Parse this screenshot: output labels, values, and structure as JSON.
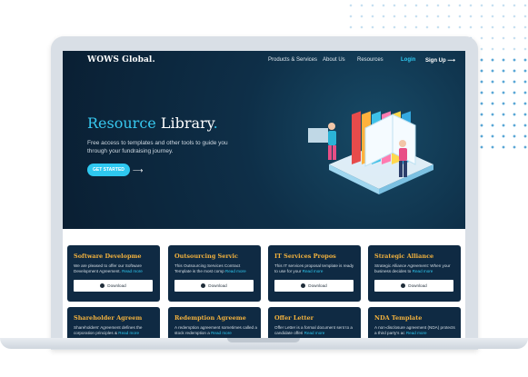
{
  "nav": {
    "logo": "WOWS Global.",
    "links": [
      "Products & Services",
      "About Us",
      "Resources"
    ],
    "login": "Login",
    "signup": "Sign Up",
    "signup_arrow": "⟶"
  },
  "hero": {
    "title_word1": "Resource",
    "title_word2": "Library",
    "title_dot": ".",
    "subtitle": "Free access to templates and other tools to guide you through your fundraising journey.",
    "cta_label": "GET STARTED",
    "cta_arrow": "⟶"
  },
  "cards": [
    {
      "title": "Software Developme",
      "desc": "We are pleased to offer our Software Development Agreement.",
      "more": "Read more",
      "button": "Download"
    },
    {
      "title": "Outsourcing Servic",
      "desc": "This Outsourcing Services Contract Template is the most comp",
      "more": "Read more",
      "button": "Download"
    },
    {
      "title": "IT Services Propos",
      "desc": "This IT services proposal template is ready to use for your",
      "more": "Read more",
      "button": "Download"
    },
    {
      "title": "Strategic Alliance",
      "desc": "Strategic Alliance Agreement: When your business decides to",
      "more": "Read more",
      "button": "Download"
    }
  ],
  "cards_row2": [
    {
      "title": "Shareholder Agreem",
      "desc": "Shareholders' Agreement defines the corporation principles &",
      "more": "Read more"
    },
    {
      "title": "Redemption Agreeme",
      "desc": "A redemption agreement sometimes called a stock redemption a",
      "more": "Read more"
    },
    {
      "title": "Offer Letter",
      "desc": "Offer Letter is a formal document sent to a candidate offeri",
      "more": "Read more"
    },
    {
      "title": "NDA Template",
      "desc": "A non-disclosure agreement (NDA) protects a third party's ac",
      "more": "Read more"
    }
  ],
  "colors": {
    "accent": "#2ec8f0",
    "card_bg": "#0f2a43",
    "card_title": "#f3b23d",
    "hero_bg": "#0a1f33"
  }
}
